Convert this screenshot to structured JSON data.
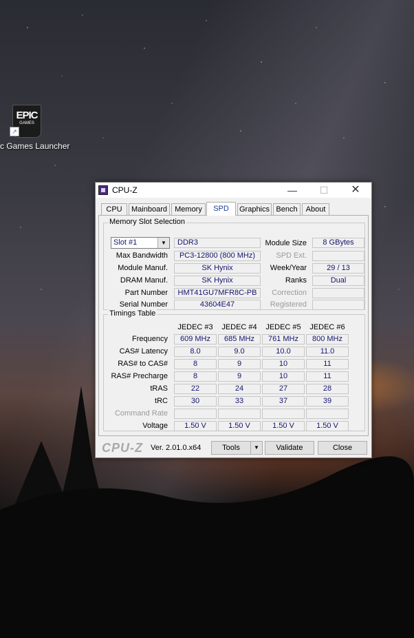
{
  "desktop": {
    "icon_logo_text": "EPIC",
    "icon_logo_sub": "GAMES",
    "icon_label": "c Games Launcher"
  },
  "window": {
    "title": "CPU-Z",
    "controls": {
      "minimize": "—",
      "maximize": "☐",
      "close": "✕"
    },
    "tabs": [
      "CPU",
      "Mainboard",
      "Memory",
      "SPD",
      "Graphics",
      "Bench",
      "About"
    ],
    "active_tab": "SPD"
  },
  "slot": {
    "group_title": "Memory Slot Selection",
    "selected": "Slot #1",
    "type": "DDR3",
    "labels": {
      "max_bandwidth": "Max Bandwidth",
      "module_manuf": "Module Manuf.",
      "dram_manuf": "DRAM Manuf.",
      "part_number": "Part Number",
      "serial_number": "Serial Number",
      "module_size": "Module Size",
      "spd_ext": "SPD Ext.",
      "week_year": "Week/Year",
      "ranks": "Ranks",
      "correction": "Correction",
      "registered": "Registered"
    },
    "values": {
      "max_bandwidth": "PC3-12800 (800 MHz)",
      "module_manuf": "SK Hynix",
      "dram_manuf": "SK Hynix",
      "part_number": "HMT41GU7MFR8C-PB",
      "serial_number": "43604E47",
      "module_size": "8 GBytes",
      "spd_ext": "",
      "week_year": "29 / 13",
      "ranks": "Dual",
      "correction": "",
      "registered": ""
    }
  },
  "timings": {
    "group_title": "Timings Table",
    "columns": [
      "JEDEC #3",
      "JEDEC #4",
      "JEDEC #5",
      "JEDEC #6"
    ],
    "rows": [
      {
        "label": "Frequency",
        "values": [
          "609 MHz",
          "685 MHz",
          "761 MHz",
          "800 MHz"
        ]
      },
      {
        "label": "CAS# Latency",
        "values": [
          "8.0",
          "9.0",
          "10.0",
          "11.0"
        ]
      },
      {
        "label": "RAS# to CAS#",
        "values": [
          "8",
          "9",
          "10",
          "11"
        ]
      },
      {
        "label": "RAS# Precharge",
        "values": [
          "8",
          "9",
          "10",
          "11"
        ]
      },
      {
        "label": "tRAS",
        "values": [
          "22",
          "24",
          "27",
          "28"
        ]
      },
      {
        "label": "tRC",
        "values": [
          "30",
          "33",
          "37",
          "39"
        ]
      },
      {
        "label": "Command Rate",
        "values": [
          "",
          "",
          "",
          ""
        ]
      },
      {
        "label": "Voltage",
        "values": [
          "1.50 V",
          "1.50 V",
          "1.50 V",
          "1.50 V"
        ]
      }
    ]
  },
  "footer": {
    "brand": "CPU-Z",
    "version": "Ver. 2.01.0.x64",
    "tools": "Tools",
    "validate": "Validate",
    "close": "Close"
  }
}
